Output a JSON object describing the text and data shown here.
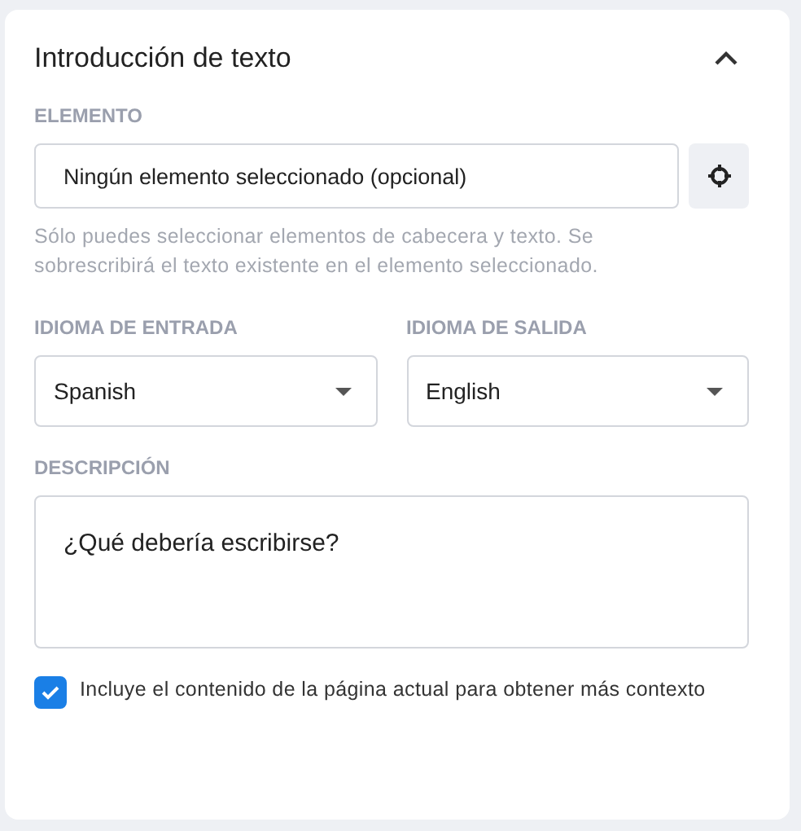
{
  "panel": {
    "title": "Introducción de texto",
    "expanded": true
  },
  "element": {
    "label": "ELEMENTO",
    "placeholder": "Ningún elemento seleccionado (opcional)",
    "hint": "Sólo puedes seleccionar elementos de cabecera y texto. Se sobrescribirá el texto existente en el elemento seleccionado."
  },
  "languages": [
    {
      "label": "IDIOMA DE ENTRADA",
      "value": "Spanish"
    },
    {
      "label": "IDIOMA DE SALIDA",
      "value": "English"
    }
  ],
  "description": {
    "label": "DESCRIPCIÓN",
    "placeholder": "¿Qué debería escribirse?"
  },
  "include_context": {
    "label": "Incluye el contenido de la página actual para obtener más contexto",
    "checked": true
  }
}
